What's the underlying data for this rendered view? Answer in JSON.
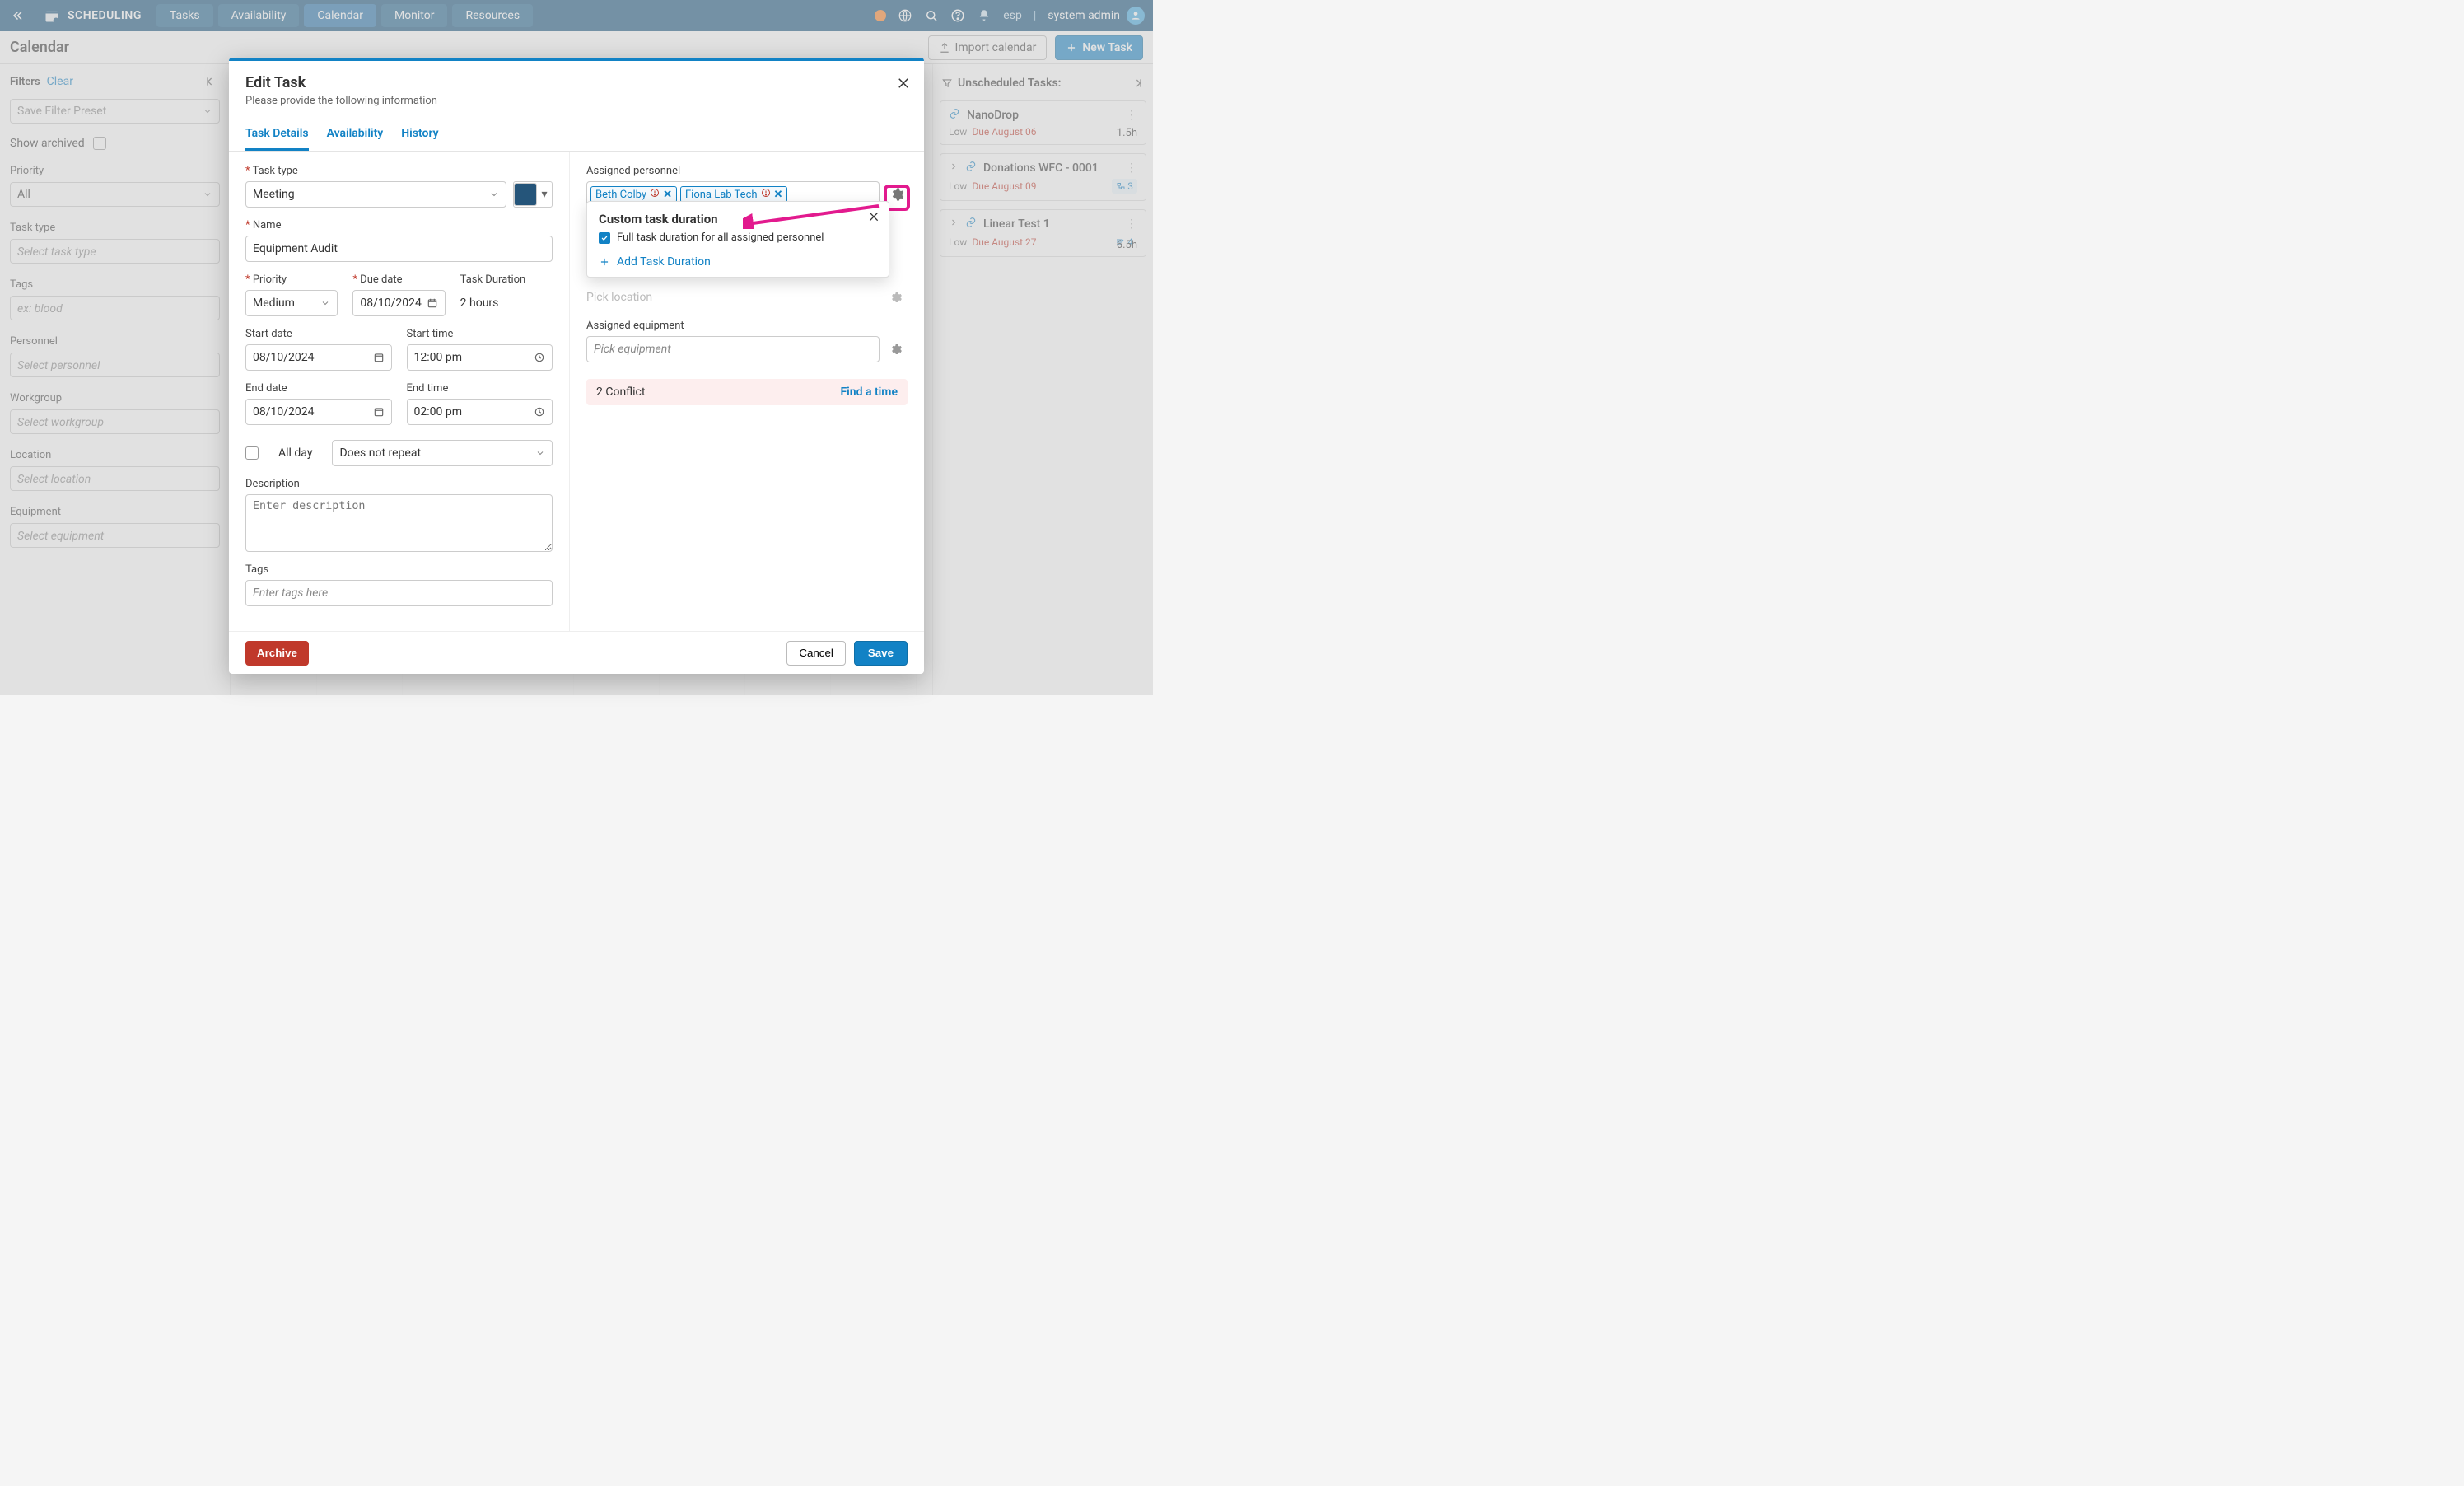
{
  "top": {
    "brand": "SCHEDULING",
    "tabs": [
      "Tasks",
      "Availability",
      "Calendar",
      "Monitor",
      "Resources"
    ],
    "active_tab": 2,
    "lang": "esp",
    "user": "system admin"
  },
  "page": {
    "title": "Calendar",
    "import_btn": "Import calendar",
    "new_btn": "New Task"
  },
  "filters": {
    "label": "Filters",
    "clear": "Clear",
    "preset_placeholder": "Save Filter Preset",
    "show_archived_label": "Show archived",
    "priority_label": "Priority",
    "priority_value": "All",
    "task_type_label": "Task type",
    "task_type_placeholder": "Select task type",
    "tags_label": "Tags",
    "tags_placeholder": "ex: blood",
    "personnel_label": "Personnel",
    "personnel_placeholder": "Select personnel",
    "workgroup_label": "Workgroup",
    "workgroup_placeholder": "Select workgroup",
    "location_label": "Location",
    "location_placeholder": "Select location",
    "equipment_label": "Equipment",
    "equipment_placeholder": "Select equipment"
  },
  "unscheduled": {
    "title": "Unscheduled Tasks:",
    "tasks": [
      {
        "name": "NanoDrop",
        "prio": "Low",
        "due": "Due August 06",
        "hours": "1.5h",
        "link": true,
        "badge": null
      },
      {
        "name": "Donations WFC - 0001",
        "prio": "Low",
        "due": "Due August 09",
        "hours": "",
        "link": true,
        "badge": "3"
      },
      {
        "name": "Linear Test 1",
        "prio": "Low",
        "due": "Due August 27",
        "hours": "6.5h",
        "link": true,
        "badge": "4"
      }
    ]
  },
  "modal": {
    "title": "Edit Task",
    "subtitle": "Please provide the following information",
    "tabs": [
      "Task Details",
      "Availability",
      "History"
    ],
    "left": {
      "task_type_label": "Task type",
      "task_type_value": "Meeting",
      "color": "#25557a",
      "name_label": "Name",
      "name_value": "Equipment Audit",
      "priority_label": "Priority",
      "priority_value": "Medium",
      "due_label": "Due date",
      "due_value": "08/10/2024",
      "duration_label": "Task Duration",
      "duration_value": "2 hours",
      "start_date_label": "Start date",
      "start_date_value": "08/10/2024",
      "start_time_label": "Start time",
      "start_time_value": "12:00 pm",
      "end_date_label": "End date",
      "end_date_value": "08/10/2024",
      "end_time_label": "End time",
      "end_time_value": "02:00 pm",
      "all_day_label": "All day",
      "repeat_value": "Does not repeat",
      "description_label": "Description",
      "description_placeholder": "Enter description",
      "tags_label": "Tags",
      "tags_placeholder": "Enter tags here"
    },
    "right": {
      "assigned_personnel_label": "Assigned personnel",
      "personnel": [
        "Beth Colby",
        "Fiona Lab Tech"
      ],
      "popover": {
        "title": "Custom task duration",
        "checkbox_label": "Full task duration for all assigned personnel",
        "add_label": "Add Task Duration"
      },
      "location_placeholder": "Pick location",
      "assigned_equipment_label": "Assigned equipment",
      "equipment_placeholder": "Pick equipment",
      "conflict_text": "2 Conflict",
      "find_time": "Find a time"
    },
    "footer": {
      "archive": "Archive",
      "cancel": "Cancel",
      "save": "Save"
    }
  }
}
